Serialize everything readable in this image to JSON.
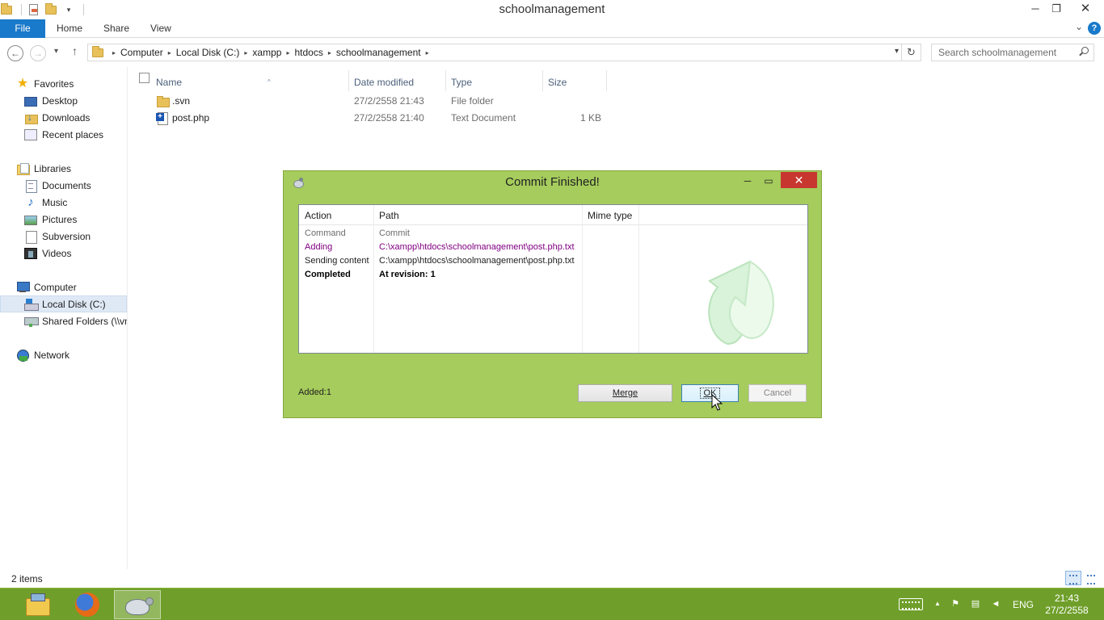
{
  "window": {
    "title": "schoolmanagement",
    "min_symbol": "─",
    "restore_symbol": "❐",
    "close_symbol": "✕"
  },
  "ribbon": {
    "tabs": [
      "File",
      "Home",
      "Share",
      "View"
    ],
    "help_symbol": "?",
    "expand_symbol": "⌄"
  },
  "address": {
    "back_symbol": "←",
    "forward_symbol": "→",
    "up_symbol": "↑",
    "recent_symbol": "▾",
    "crumbs": [
      "Computer",
      "Local Disk (C:)",
      "xampp",
      "htdocs",
      "schoolmanagement"
    ],
    "crumb_arrow": "▸",
    "dropdown_symbol": "▾",
    "refresh_symbol": "↻",
    "search_placeholder": "Search schoolmanagement"
  },
  "sidebar": {
    "favorites": {
      "label": "Favorites",
      "items": [
        "Desktop",
        "Downloads",
        "Recent places"
      ]
    },
    "libraries": {
      "label": "Libraries",
      "items": [
        "Documents",
        "Music",
        "Pictures",
        "Subversion",
        "Videos"
      ]
    },
    "computer": {
      "label": "Computer",
      "items": [
        "Local Disk (C:)",
        "Shared Folders (\\\\vn"
      ]
    },
    "network": {
      "label": "Network"
    }
  },
  "filelist": {
    "columns": [
      "Name",
      "Date modified",
      "Type",
      "Size"
    ],
    "sort_symbol": "^",
    "rows": [
      {
        "name": ".svn",
        "date": "27/2/2558 21:43",
        "type": "File folder",
        "size": ""
      },
      {
        "name": "post.php",
        "date": "27/2/2558 21:40",
        "type": "Text Document",
        "size": "1 KB"
      }
    ]
  },
  "statusbar": {
    "count": "2 items"
  },
  "dialog": {
    "title": "Commit Finished!",
    "min_symbol": "─",
    "max_symbol": "▭",
    "close_symbol": "✕",
    "columns": [
      "Action",
      "Path",
      "Mime type"
    ],
    "rows": [
      {
        "action": "Command",
        "path": "Commit"
      },
      {
        "action": "Adding",
        "path": "C:\\xampp\\htdocs\\schoolmanagement\\post.php.txt"
      },
      {
        "action": "Sending content",
        "path": "C:\\xampp\\htdocs\\schoolmanagement\\post.php.txt"
      },
      {
        "action": "Completed",
        "path": "At revision: 1"
      }
    ],
    "summary": "Added:1",
    "merge_label": "Merge",
    "ok_label": "OK",
    "cancel_label": "Cancel"
  },
  "taskbar": {
    "language": "ENG",
    "time": "21:43",
    "date": "27/2/2558",
    "tray_up_symbol": "▲"
  },
  "colors": {
    "dialog_bg": "#a5cc5c",
    "taskbar_bg": "#6f9f2a",
    "file_tab": "#1979ca",
    "close_red": "#c7372f",
    "adding_purple": "#800080"
  }
}
